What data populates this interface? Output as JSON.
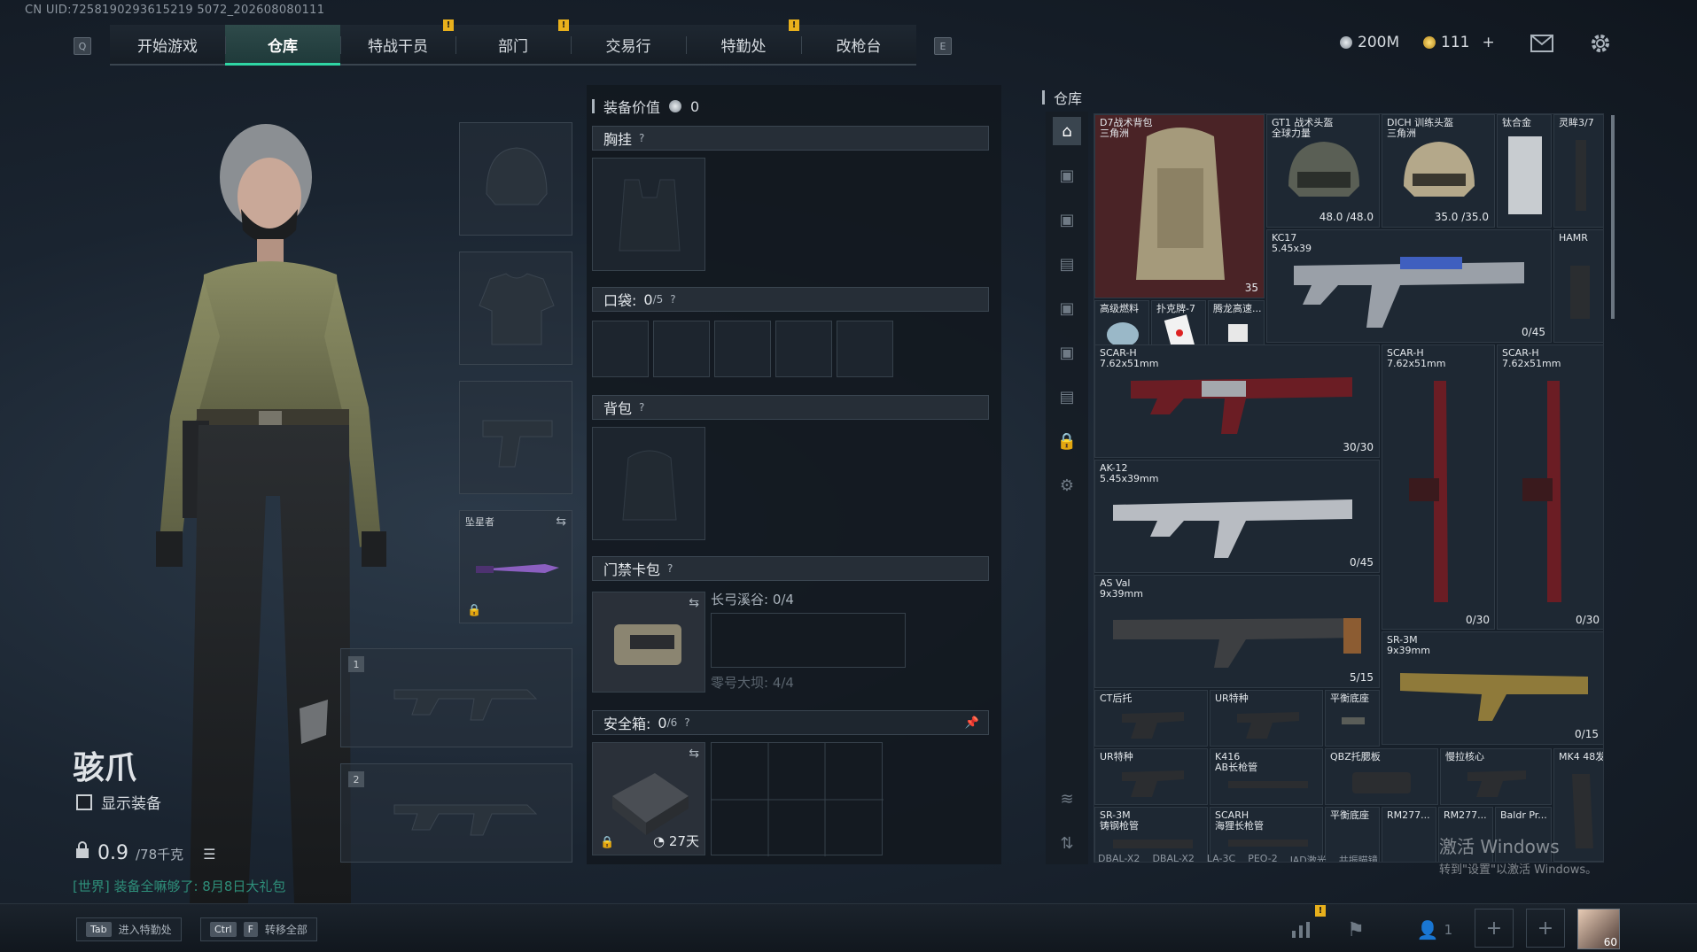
{
  "uid": "CN UID:7258190293615219 5072_202608080111",
  "nav": {
    "left_key": "Q",
    "right_key": "E",
    "tabs": [
      {
        "label": "开始游戏",
        "badge": ""
      },
      {
        "label": "仓库",
        "badge": ""
      },
      {
        "label": "特战干员",
        "badge": "!"
      },
      {
        "label": "部门",
        "badge": "!"
      },
      {
        "label": "交易行",
        "badge": ""
      },
      {
        "label": "特勤处",
        "badge": "!"
      },
      {
        "label": "改枪台",
        "badge": ""
      }
    ]
  },
  "currency": {
    "silver": "200M",
    "gold": "111",
    "gold_plus": "+"
  },
  "icons": {
    "mail": "mail-icon",
    "settings": "gear-icon"
  },
  "character": {
    "name": "骇爪",
    "show_equipment": "显示装备",
    "weight_value": "0.9",
    "weight_max": "/78千克",
    "world_message": "[世界] 装备全嘛够了: 8月8日大礼包"
  },
  "slots": {
    "melee_label": "坠星者",
    "weapon1_tag": "1",
    "weapon2_tag": "2"
  },
  "middle": {
    "value_label": "装备价值",
    "value_amount": "0",
    "chest_label": "胸挂",
    "pocket_label": "口袋:",
    "pocket_count": "0",
    "pocket_max": "/5",
    "backpack_label": "背包",
    "card_label": "门禁卡包",
    "card_line1": "长弓溪谷: 0/4",
    "card_line2": "零号大坝: 4/4",
    "safe_label": "安全箱:",
    "safe_count": "0",
    "safe_max": "/6",
    "safe_timer": "27天",
    "help": "?"
  },
  "warehouse": {
    "title": "仓库",
    "items": [
      {
        "name": "D7战术背包\n三角洲",
        "count": "35"
      },
      {
        "name": "GT1 战术头盔\n全球力量",
        "count": "48.0 /48.0"
      },
      {
        "name": "DICH 训练头盔\n三角洲",
        "count": "35.0 /35.0"
      },
      {
        "name": "钛合金",
        "count": ""
      },
      {
        "name": "灵眸3/7",
        "count": ""
      },
      {
        "name": "KC17\n5.45x39",
        "count": "0/45"
      },
      {
        "name": "HAMR",
        "count": ""
      },
      {
        "name": "高级燃料",
        "count": ""
      },
      {
        "name": "扑克牌-7",
        "count": ""
      },
      {
        "name": "腾龙高速...",
        "count": ""
      },
      {
        "name": "SCAR-H\n7.62x51mm",
        "count": "30/30"
      },
      {
        "name": "SCAR-H\n7.62x51mm",
        "count": ""
      },
      {
        "name": "SCAR-H\n7.62x51mm",
        "count": ""
      },
      {
        "name": "AK-12\n5.45x39mm",
        "count": "0/45"
      },
      {
        "name": "",
        "count": "0/30"
      },
      {
        "name": "",
        "count": "0/30"
      },
      {
        "name": "AS Val\n9x39mm",
        "count": "5/15"
      },
      {
        "name": "SR-3M\n9x39mm",
        "count": "0/15"
      },
      {
        "name": "CT后托",
        "count": ""
      },
      {
        "name": "UR特种",
        "count": ""
      },
      {
        "name": "平衡底座",
        "count": ""
      },
      {
        "name": "UR特种",
        "count": ""
      },
      {
        "name": "K416\nAB长枪管",
        "count": ""
      },
      {
        "name": "QBZ托腮板",
        "count": ""
      },
      {
        "name": "慢拉核心",
        "count": ""
      },
      {
        "name": "MK4 48发",
        "count": ""
      },
      {
        "name": "SR-3M\n铸钢枪管",
        "count": ""
      },
      {
        "name": "SCARH\n海狸长枪管",
        "count": ""
      },
      {
        "name": "平衡底座",
        "count": ""
      },
      {
        "name": "RM277...",
        "count": ""
      },
      {
        "name": "RM277...",
        "count": ""
      },
      {
        "name": "Baldr Pr...",
        "count": ""
      }
    ],
    "bottom_row": [
      "DBAL-X2",
      "DBAL-X2",
      "LA-3C",
      "PEQ-2",
      "JAD激光",
      "共振瞄镜"
    ]
  },
  "bottom": {
    "tab_key": "Tab",
    "tab_label": "进入特勤处",
    "ctrl_key": "Ctrl",
    "f_key": "F",
    "transfer_label": "转移全部",
    "team_count": "1",
    "level": "60",
    "stats_badge": "!"
  },
  "watermark": {
    "line1": "激活 Windows",
    "line2": "转到\"设置\"以激活 Windows。"
  },
  "colors": {
    "accent": "#2fd6a4",
    "badge": "#e8b01c",
    "red_item": "#4a2326"
  }
}
